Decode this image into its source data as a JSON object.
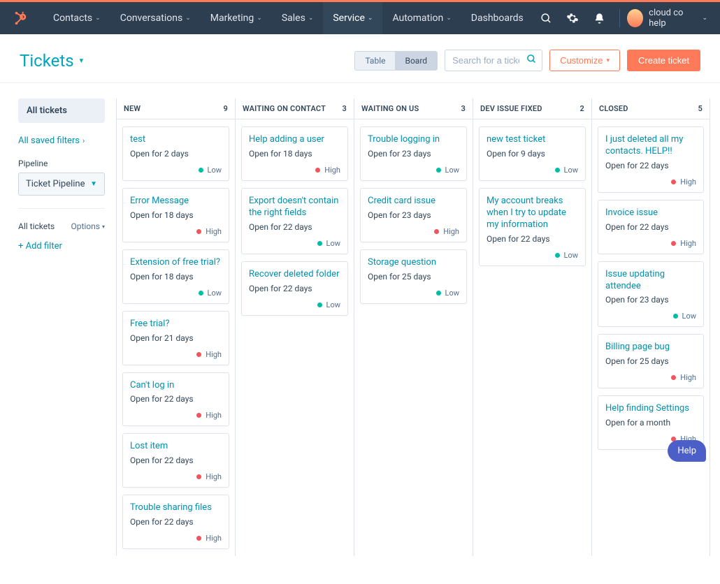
{
  "nav": {
    "items": [
      {
        "label": "Contacts",
        "dropdown": true
      },
      {
        "label": "Conversations",
        "dropdown": true
      },
      {
        "label": "Marketing",
        "dropdown": true
      },
      {
        "label": "Sales",
        "dropdown": true
      },
      {
        "label": "Service",
        "dropdown": true,
        "active": true
      },
      {
        "label": "Automation",
        "dropdown": true
      },
      {
        "label": "Dashboards",
        "dropdown": false
      }
    ],
    "user_label": "cloud co help"
  },
  "page": {
    "title": "Tickets",
    "view_table": "Table",
    "view_board": "Board",
    "search_placeholder": "Search for a ticket",
    "customize": "Customize",
    "create": "Create ticket"
  },
  "sidebar": {
    "all_tickets": "All tickets",
    "all_saved_filters": "All saved filters",
    "pipeline_label": "Pipeline",
    "pipeline_value": "Ticket Pipeline",
    "filters_label": "All tickets",
    "options": "Options",
    "add_filter": "Add filter"
  },
  "columns": [
    {
      "name": "NEW",
      "count": 9,
      "cards": [
        {
          "title": "test",
          "sub": "Open for 2 days",
          "priority": "Low"
        },
        {
          "title": "Error Message",
          "sub": "Open for 18 days",
          "priority": "High"
        },
        {
          "title": "Extension of free trial?",
          "sub": "Open for 18 days",
          "priority": "Low"
        },
        {
          "title": "Free trial?",
          "sub": "Open for 21 days",
          "priority": "High"
        },
        {
          "title": "Can't log in",
          "sub": "Open for 22 days",
          "priority": "High"
        },
        {
          "title": "Lost item",
          "sub": "Open for 22 days",
          "priority": "High"
        },
        {
          "title": "Trouble sharing files",
          "sub": "Open for 22 days",
          "priority": "High"
        }
      ]
    },
    {
      "name": "WAITING ON CONTACT",
      "count": 3,
      "cards": [
        {
          "title": "Help adding a user",
          "sub": "Open for 18 days",
          "priority": "High"
        },
        {
          "title": "Export doesn't contain the right fields",
          "sub": "Open for 22 days",
          "priority": "Low"
        },
        {
          "title": "Recover deleted folder",
          "sub": "Open for 22 days",
          "priority": "Low"
        }
      ]
    },
    {
      "name": "WAITING ON US",
      "count": 3,
      "cards": [
        {
          "title": "Trouble logging in",
          "sub": "Open for 23 days",
          "priority": "Low"
        },
        {
          "title": "Credit card issue",
          "sub": "Open for 23 days",
          "priority": "High"
        },
        {
          "title": "Storage question",
          "sub": "Open for 25 days",
          "priority": "Low"
        }
      ]
    },
    {
      "name": "DEV ISSUE FIXED",
      "count": 2,
      "cards": [
        {
          "title": "new test ticket",
          "sub": "Open for 9 days",
          "priority": "Low"
        },
        {
          "title": "My account breaks when I try to update my information",
          "sub": "Open for 22 days",
          "priority": "Low"
        }
      ]
    },
    {
      "name": "CLOSED",
      "count": 5,
      "cards": [
        {
          "title": "I just deleted all my contacts. HELP!!",
          "sub": "Open for 22 days",
          "priority": "High"
        },
        {
          "title": "Invoice issue",
          "sub": "Open for 22 days",
          "priority": "High"
        },
        {
          "title": "Issue updating attendee",
          "sub": "Open for 23 days",
          "priority": "Low"
        },
        {
          "title": "Billing page bug",
          "sub": "Open for 25 days",
          "priority": "High"
        },
        {
          "title": "Help finding Settings",
          "sub": "Open for a month",
          "priority": "High"
        }
      ]
    }
  ],
  "help": "Help"
}
